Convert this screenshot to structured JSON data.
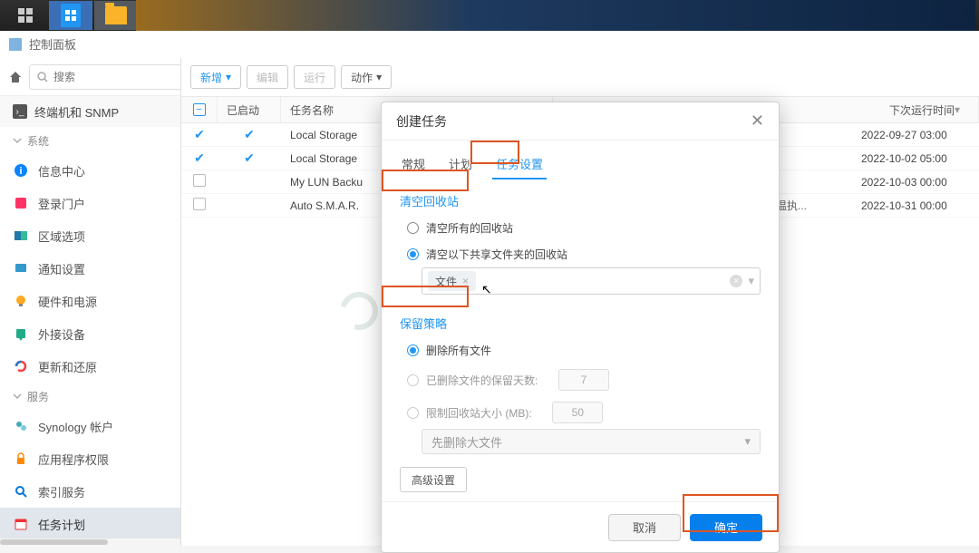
{
  "taskbar": {},
  "window_title": "控制面板",
  "topbar": {
    "search_placeholder": "搜索"
  },
  "crumb": {
    "label": "终端机和 SNMP"
  },
  "sidebar": {
    "groups": [
      {
        "title": "系统",
        "items": [
          {
            "icon": "info",
            "label": "信息中心",
            "color": "#0a84ff"
          },
          {
            "icon": "login",
            "label": "登录门户",
            "color": "#f36"
          },
          {
            "icon": "region",
            "label": "区域选项",
            "color": "#3b9"
          },
          {
            "icon": "notify",
            "label": "通知设置",
            "color": "#39c"
          },
          {
            "icon": "hw",
            "label": "硬件和电源",
            "color": "#fa2"
          },
          {
            "icon": "ext",
            "label": "外接设备",
            "color": "#2a8"
          },
          {
            "icon": "update",
            "label": "更新和还原",
            "color": "#e44"
          }
        ]
      },
      {
        "title": "服务",
        "items": [
          {
            "icon": "acct",
            "label": "Synology 帐户",
            "color": "#4ab"
          },
          {
            "icon": "perm",
            "label": "应用程序权限",
            "color": "#f80"
          },
          {
            "icon": "index",
            "label": "索引服务",
            "color": "#07d"
          },
          {
            "icon": "sched",
            "label": "任务计划",
            "color": "#e33",
            "active": true
          }
        ]
      }
    ]
  },
  "toolbar": {
    "new": "新增",
    "edit": "编辑",
    "run": "运行",
    "action": "动作"
  },
  "table": {
    "headers": {
      "enabled": "已启动",
      "name": "任务名称",
      "next": "下次运行时间"
    },
    "rows": [
      {
        "enabled": true,
        "name": "Local Storage",
        "extra": "",
        "next": "2022-09-27 03:00"
      },
      {
        "enabled": true,
        "name": "Local Storage",
        "extra": "",
        "next": "2022-10-02 05:00"
      },
      {
        "enabled": false,
        "name": "My LUN Backu",
        "extra": "",
        "next": "2022-10-03 00:00"
      },
      {
        "enabled": false,
        "name": "Auto S.M.A.R.",
        "extra": "温执...",
        "next": "2022-10-31 00:00"
      }
    ]
  },
  "dialog": {
    "title": "创建任务",
    "tabs": {
      "general": "常规",
      "schedule": "计划",
      "settings": "任务设置"
    },
    "section_recycle": "清空回收站",
    "opt_all": "清空所有的回收站",
    "opt_selected": "清空以下共享文件夹的回收站",
    "tag": "文件",
    "section_retention": "保留策略",
    "ret_all": "删除所有文件",
    "ret_days": "已删除文件的保留天数:",
    "ret_days_val": "7",
    "ret_size": "限制回收站大小 (MB):",
    "ret_size_val": "50",
    "ret_order": "先删除大文件",
    "advanced": "高级设置",
    "cancel": "取消",
    "ok": "确定"
  }
}
